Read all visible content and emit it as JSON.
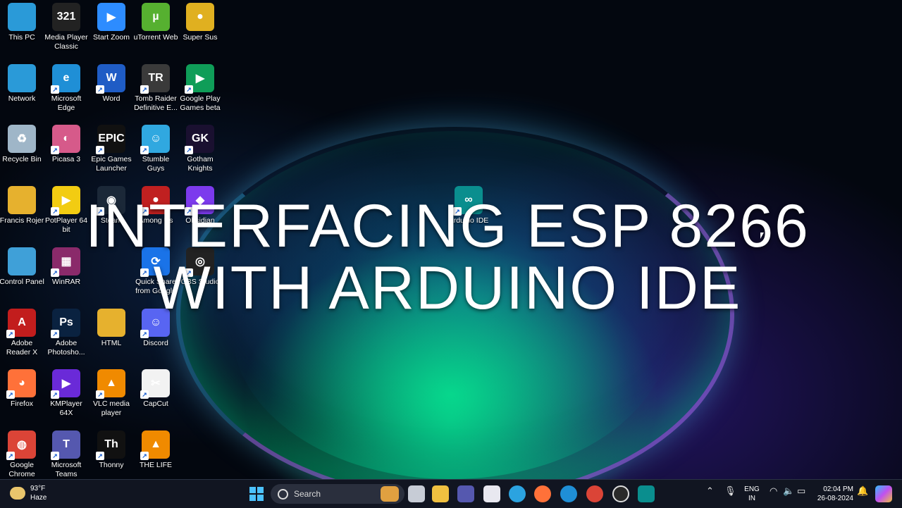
{
  "desktop": {
    "icons": [
      {
        "label": "This PC",
        "glyph": "",
        "color": "#2a9ad8"
      },
      {
        "label": "Media Player Classic",
        "glyph": "321",
        "color": "#222"
      },
      {
        "label": "Start Zoom",
        "glyph": "▶",
        "color": "#2d8cff"
      },
      {
        "label": "uTorrent Web",
        "glyph": "µ",
        "color": "#56b030"
      },
      {
        "label": "Super Sus",
        "glyph": "●",
        "color": "#e0b020"
      },
      {
        "label": "Network",
        "glyph": "",
        "color": "#2a9ad8"
      },
      {
        "label": "Microsoft Edge",
        "glyph": "e",
        "color": "#1f8fd6"
      },
      {
        "label": "Word",
        "glyph": "W",
        "color": "#1f5cc5"
      },
      {
        "label": "Tomb Raider Definitive E...",
        "glyph": "TR",
        "color": "#3a3a3a"
      },
      {
        "label": "Google Play Games beta",
        "glyph": "▶",
        "color": "#0f9d58"
      },
      {
        "label": "Recycle Bin",
        "glyph": "♻",
        "color": "#9fb6c8"
      },
      {
        "label": "Picasa 3",
        "glyph": "◐",
        "color": "#d65a8a"
      },
      {
        "label": "Epic Games Launcher",
        "glyph": "EPIC",
        "color": "#111"
      },
      {
        "label": "Stumble Guys",
        "glyph": "☺",
        "color": "#30a8e0"
      },
      {
        "label": "Gotham Knights",
        "glyph": "GK",
        "color": "#1a1030"
      },
      {
        "label": "Francis Rojer",
        "glyph": "",
        "color": "#e6b12e"
      },
      {
        "label": "PotPlayer 64 bit",
        "glyph": "▶",
        "color": "#f2cc12"
      },
      {
        "label": "Steam",
        "glyph": "◉",
        "color": "#1b2838"
      },
      {
        "label": "Among Us",
        "glyph": "●",
        "color": "#c02020"
      },
      {
        "label": "Obsidian",
        "glyph": "◆",
        "color": "#7c3aed"
      },
      {
        "label": "Arduino IDE",
        "glyph": "∞",
        "color": "#0a8e8e"
      },
      {
        "label": "Control Panel",
        "glyph": "",
        "color": "#3fa0d8"
      },
      {
        "label": "WinRAR",
        "glyph": "▦",
        "color": "#8a2a6a"
      },
      {
        "label": "Quick Share from Google",
        "glyph": "⟳",
        "color": "#1a73e8"
      },
      {
        "label": "OBS Studio",
        "glyph": "◎",
        "color": "#222"
      },
      {
        "label": "Adobe Reader X",
        "glyph": "A",
        "color": "#c21d1d"
      },
      {
        "label": "Adobe Photosho...",
        "glyph": "Ps",
        "color": "#0a2240"
      },
      {
        "label": "HTML",
        "glyph": "",
        "color": "#e6b12e"
      },
      {
        "label": "Discord",
        "glyph": "☺",
        "color": "#5865f2"
      },
      {
        "label": "Firefox",
        "glyph": "◕",
        "color": "#ff7139"
      },
      {
        "label": "KMPlayer 64X",
        "glyph": "▶",
        "color": "#6a2ad8"
      },
      {
        "label": "VLC media player",
        "glyph": "▲",
        "color": "#f08a00"
      },
      {
        "label": "CapCut",
        "glyph": "✂",
        "color": "#f2f2f2"
      },
      {
        "label": "Google Chrome",
        "glyph": "◍",
        "color": "#db4437"
      },
      {
        "label": "Microsoft Teams",
        "glyph": "T",
        "color": "#5558af"
      },
      {
        "label": "Thonny",
        "glyph": "Th",
        "color": "#111"
      },
      {
        "label": "THE LIFE",
        "glyph": "▲",
        "color": "#f08a00"
      }
    ]
  },
  "overlay": {
    "line1": "INTERFACING ESP 8266",
    "line2": "WITH ARDUINO IDE"
  },
  "taskbar": {
    "weather_temp": "93°F",
    "weather_desc": "Haze",
    "search_placeholder": "Search",
    "lang_line1": "ENG",
    "lang_line2": "IN",
    "time": "02:04 PM",
    "date": "26-08-2024"
  }
}
